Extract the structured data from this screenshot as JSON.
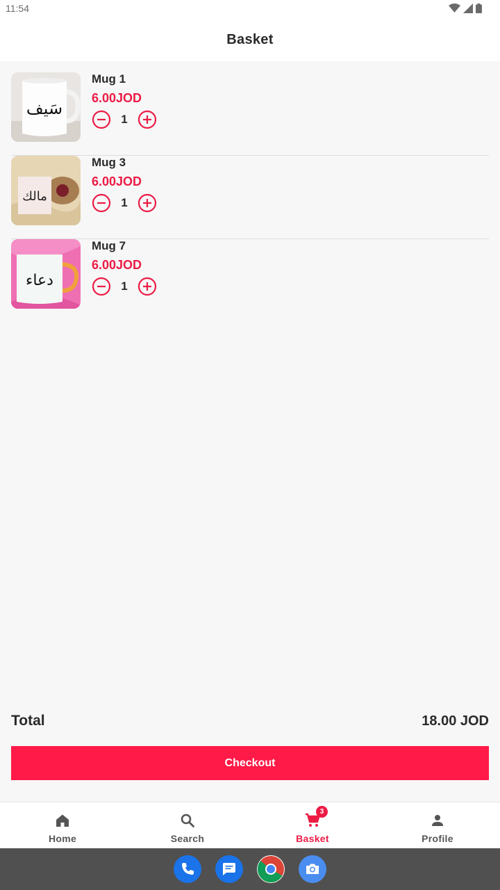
{
  "status_bar": {
    "time": "11:54"
  },
  "header": {
    "title": "Basket"
  },
  "basket": {
    "items": [
      {
        "name": "Mug 1",
        "price": "6.00JOD",
        "quantity": "1",
        "calligraphy": "سَيف"
      },
      {
        "name": "Mug 3",
        "price": "6.00JOD",
        "quantity": "1",
        "calligraphy": "مالك"
      },
      {
        "name": "Mug 7",
        "price": "6.00JOD",
        "quantity": "1",
        "calligraphy": "دعاء"
      }
    ]
  },
  "summary": {
    "total_label": "Total",
    "total_value": "18.00 JOD"
  },
  "checkout": {
    "label": "Checkout"
  },
  "nav": {
    "items": [
      {
        "label": "Home",
        "icon": "home-icon"
      },
      {
        "label": "Search",
        "icon": "search-icon"
      },
      {
        "label": "Basket",
        "icon": "cart-icon",
        "badge": "3",
        "active": true
      },
      {
        "label": "Profile",
        "icon": "person-icon"
      }
    ]
  },
  "dock": {
    "apps": [
      "phone-icon",
      "messages-icon",
      "chrome-icon",
      "camera-icon"
    ]
  },
  "colors": {
    "accent": "#ec1b45",
    "button": "#ff1a47",
    "background": "#f7f7f7"
  }
}
